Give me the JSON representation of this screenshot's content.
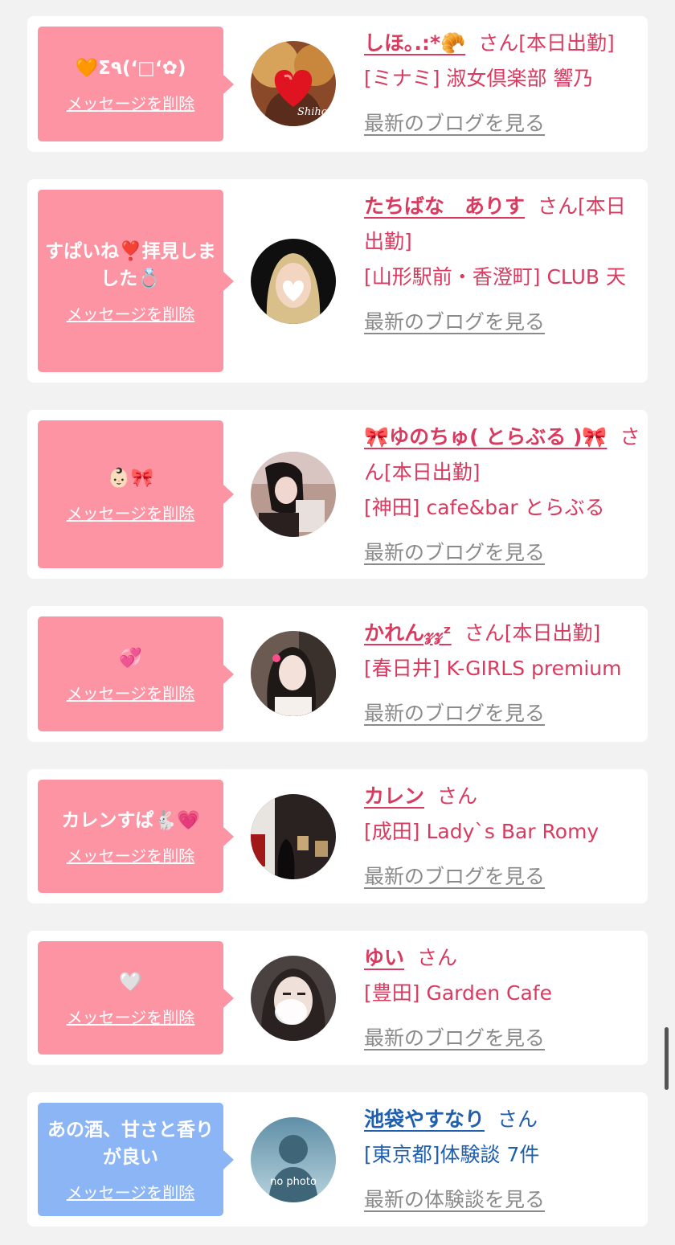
{
  "colors": {
    "page_bg": "#f2f2f2",
    "bubble_pink": "#fd94a4",
    "bubble_blue": "#8cb5f6",
    "name_pink": "#d93a5f",
    "name_blue": "#1f5fad",
    "link_gray": "#8a8a8a"
  },
  "delete_label": "メッセージを削除",
  "entries": [
    {
      "message": "🧡Σ٩(ʻ□ʻ✿)",
      "name": "しほ｡.:*🥐",
      "san": "さん[本日出勤]",
      "shop": "[ミナミ] 淑女倶楽部 響乃",
      "link": "最新のブログを見る",
      "avatar_icon": "avatar-heart-photo"
    },
    {
      "message": "すぱいね❣️拝見しました💍",
      "name": "たちばな　ありす",
      "san": "さん[本日出勤]",
      "shop": "[山形駅前・香澄町] CLUB 天",
      "link": "最新のブログを見る",
      "avatar_icon": "avatar-blonde-photo"
    },
    {
      "message": "👶🏻🎀",
      "name": "🎀ゆのちゅ( とらぶる )🎀",
      "san": "さん[本日出勤]",
      "shop": "[神田] cafe&bar とらぶる",
      "link": "最新のブログを見る",
      "avatar_icon": "avatar-girl-photo"
    },
    {
      "message": "💞",
      "name": "かれん𝓏𝓏ᶻ",
      "san": "さん[本日出勤]",
      "shop": "[春日井] K-GIRLS premium",
      "link": "最新のブログを見る",
      "avatar_icon": "avatar-selfie-photo"
    },
    {
      "message": "カレンすぱ🐇💗",
      "name": "カレン",
      "san": "さん",
      "shop": "[成田] Lady`s Bar Romy",
      "link": "最新のブログを見る",
      "avatar_icon": "avatar-gallery-photo"
    },
    {
      "message": "🤍",
      "name": "ゆい",
      "san": "さん",
      "shop": "[豊田] Garden Cafe",
      "link": "最新のブログを見る",
      "avatar_icon": "avatar-blur-photo"
    },
    {
      "message": "あの酒、甘さと香りが良い",
      "name": "池袋やすなり",
      "san": "さん",
      "shop": "[東京都]体験談 7件",
      "link": "最新の体験談を見る",
      "avatar_icon": "avatar-no-photo",
      "avatar_text": "no photo"
    }
  ]
}
